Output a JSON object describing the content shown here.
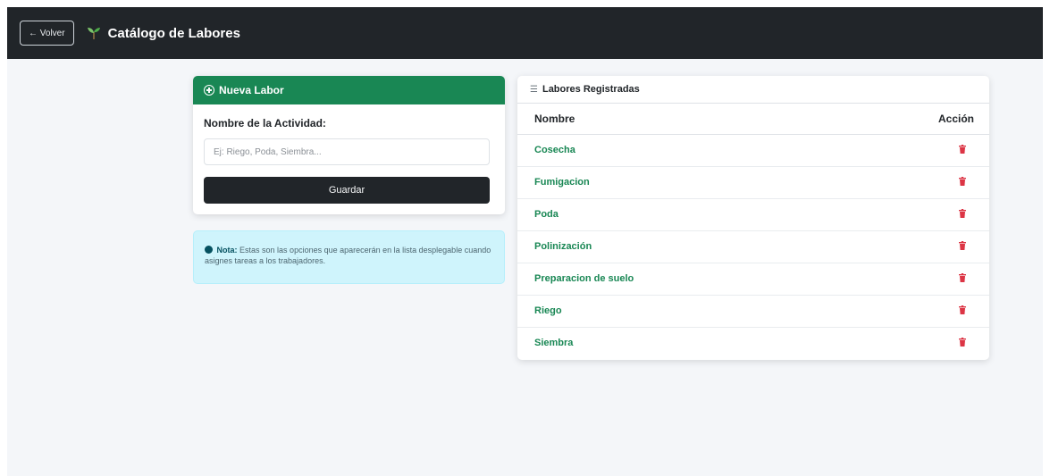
{
  "navbar": {
    "back_label": "← Volver",
    "title": "Catálogo de Labores"
  },
  "form": {
    "header": "Nueva Labor",
    "field_label": "Nombre de la Actividad:",
    "input_placeholder": "Ej: Riego, Poda, Siembra...",
    "input_value": "",
    "save_label": "Guardar"
  },
  "note": {
    "label": "Nota:",
    "text": "Estas son las opciones que aparecerán en la lista desplegable cuando asignes tareas a los trabajadores."
  },
  "list": {
    "header": "Labores Registradas",
    "columns": [
      "Nombre",
      "Acción"
    ],
    "rows": [
      {
        "name": "Cosecha"
      },
      {
        "name": "Fumigacion"
      },
      {
        "name": "Poda"
      },
      {
        "name": "Polinización"
      },
      {
        "name": "Preparacion de suelo"
      },
      {
        "name": "Riego"
      },
      {
        "name": "Siembra"
      }
    ]
  },
  "colors": {
    "navbar": "#212529",
    "primary": "#198754",
    "danger": "#dc3545",
    "info_bg": "#cff4fc"
  },
  "icons": {
    "brand": "sprout-icon",
    "form_header": "plus-circle-icon",
    "note": "info-circle-icon",
    "list_header": "list-icon",
    "row_action": "trash-icon"
  }
}
